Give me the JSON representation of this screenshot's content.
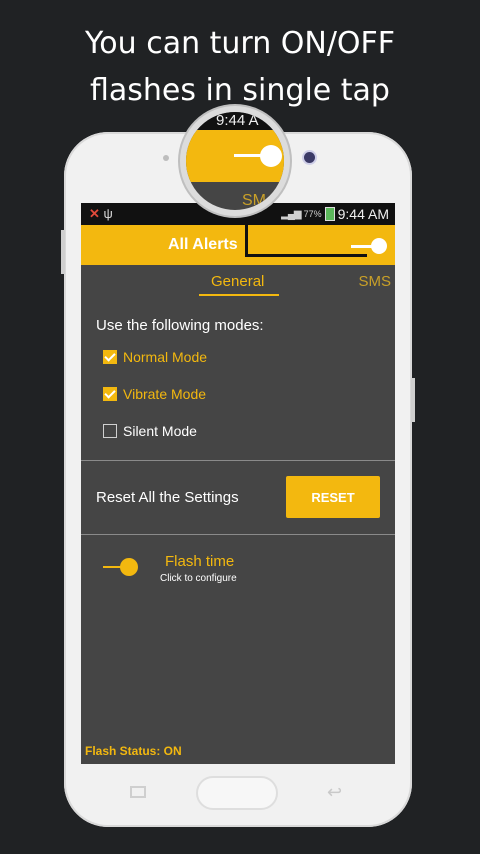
{
  "headline": {
    "line1": "You can turn ON/OFF",
    "line2": "flashes in single tap"
  },
  "status_bar": {
    "battery_percent": "77%",
    "time": "9:44 AM",
    "icons_left": [
      "missed-call-icon",
      "usb-icon"
    ]
  },
  "app_bar": {
    "title": "All Alerts",
    "toggle_on": true
  },
  "tabs": [
    {
      "label": "General",
      "active": true
    },
    {
      "label": "SMS",
      "active": false
    }
  ],
  "modes": {
    "heading": "Use the following modes:",
    "items": [
      {
        "label": "Normal Mode",
        "checked": true
      },
      {
        "label": "Vibrate Mode",
        "checked": true
      },
      {
        "label": "Silent Mode",
        "checked": false
      }
    ]
  },
  "reset": {
    "label": "Reset All the Settings",
    "button": "RESET"
  },
  "flash_time": {
    "title": "Flash time",
    "subtitle": "Click to configure"
  },
  "flash_status": "Flash Status: ON",
  "magnifier": {
    "time": "9:44 A",
    "tab": "SM"
  },
  "colors": {
    "accent": "#f3b80f",
    "background": "#454545",
    "page": "#202224"
  }
}
